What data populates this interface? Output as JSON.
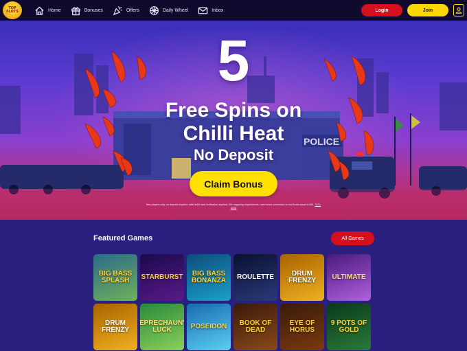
{
  "header": {
    "logo_text": "TOP SLOTS",
    "nav": [
      {
        "label": "Home",
        "icon": "home-icon"
      },
      {
        "label": "Bonuses",
        "icon": "gift-icon"
      },
      {
        "label": "Offers",
        "icon": "party-popper-icon"
      },
      {
        "label": "Daily Wheel",
        "icon": "wheel-icon"
      },
      {
        "label": "Inbox",
        "icon": "envelope-icon"
      }
    ],
    "login_label": "Login",
    "join_label": "Join",
    "profile_icon": "user-icon"
  },
  "hero": {
    "number": "5",
    "line1": "Free Spins on",
    "line2": "Chilli Heat",
    "line3": "No Deposit",
    "claim_label": "Claim Bonus",
    "terms": "New players only, no deposit required, valid debit card verification required, 65x wagering requirements, max bonus conversion to real funds equal to £50.",
    "terms_link": "T&Cs apply",
    "sign_text": "POLICE"
  },
  "games": {
    "title": "Featured Games",
    "all_label": "All Games",
    "tiles": [
      {
        "name": "BIG BASS SPLASH",
        "bg1": "#2c6b8a",
        "bg2": "#6fb05a",
        "color": "#ffd23a"
      },
      {
        "name": "STARBURST",
        "bg1": "#1a0a4a",
        "bg2": "#5a1a8a",
        "color": "#ffd23a"
      },
      {
        "name": "BIG BASS BONANZA",
        "bg1": "#0d4d7a",
        "bg2": "#1aa0c8",
        "color": "#ffd23a"
      },
      {
        "name": "ROULETTE",
        "bg1": "#0a1030",
        "bg2": "#2a3a7a",
        "color": "#ffffff"
      },
      {
        "name": "DRUM FRENZY",
        "bg1": "#a86400",
        "bg2": "#f0b020",
        "color": "#ffffff"
      },
      {
        "name": "ULTIMATE",
        "bg1": "#4a1a7a",
        "bg2": "#b060e0",
        "color": "#ffe070"
      },
      {
        "name": "DRUM FRENZY",
        "bg1": "#a86400",
        "bg2": "#f0b020",
        "color": "#ffffff"
      },
      {
        "name": "LEPRECHAUN'S LUCK",
        "bg1": "#2a8a3a",
        "bg2": "#8ad05a",
        "color": "#ffe070"
      },
      {
        "name": "POSEIDON",
        "bg1": "#1a6ab0",
        "bg2": "#5ad0f0",
        "color": "#ffd23a"
      },
      {
        "name": "BOOK OF DEAD",
        "bg1": "#3a1a0a",
        "bg2": "#8a4a1a",
        "color": "#ffd23a"
      },
      {
        "name": "EYE OF HORUS",
        "bg1": "#3a1a0a",
        "bg2": "#7a3a10",
        "color": "#ffd23a"
      },
      {
        "name": "9 POTS OF GOLD",
        "bg1": "#0a3a1a",
        "bg2": "#2a7a3a",
        "color": "#ffd23a"
      }
    ]
  },
  "colors": {
    "header_bg": "#0f0a2e",
    "login": "#d4101f",
    "join": "#ffd800",
    "claim": "#ffe000",
    "page_bg": "#2a1f7e"
  }
}
